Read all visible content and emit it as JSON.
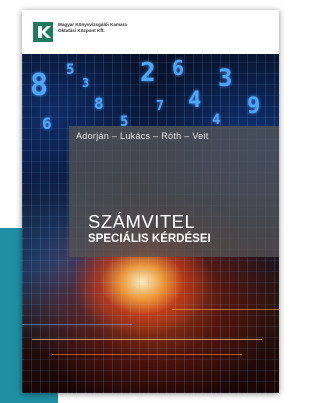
{
  "publisher": {
    "line1": "Magyar Könyvvizsgálói Kamara",
    "line2": "Oktatási Központ Kft."
  },
  "book": {
    "authors": "Adorján – Lukács – Róth – Veit",
    "title_line1": "SZÁMVITEL",
    "title_line2": "SPECIÁLIS KÉRDÉSEI"
  },
  "art_digits": [
    "8",
    "2",
    "6",
    "3",
    "5",
    "4",
    "8",
    "9",
    "5",
    "6",
    "4",
    "7",
    "3"
  ],
  "colors": {
    "accent_teal": "#1f8fa3",
    "logo_green": "#1e7a5a",
    "digit_blue": "#4fa6ff"
  }
}
